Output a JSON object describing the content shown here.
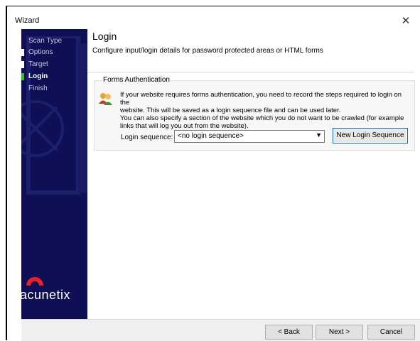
{
  "window": {
    "title": "Wizard",
    "close_glyph": "✕"
  },
  "sidebar": {
    "items": [
      {
        "label": "Scan Type",
        "state": "done"
      },
      {
        "label": "Options",
        "state": "done"
      },
      {
        "label": "Target",
        "state": "done"
      },
      {
        "label": "Login",
        "state": "active"
      },
      {
        "label": "Finish",
        "state": "pending"
      }
    ],
    "logo_text": "acunetix",
    "colors": {
      "background": "#0e0f55",
      "active_marker": "#25c725",
      "logo_red": "#e8202a"
    }
  },
  "main": {
    "title": "Login",
    "subtitle": "Configure input/login details for password protected areas or HTML forms",
    "group": {
      "label": "Forms Authentication",
      "description_lines": [
        "If your website requires forms authentication, you need to record the steps required to login on the",
        "website. This will be saved as a login sequence file and can be used later.",
        "You can also specify a section of the website which you do not want to be crawled (for example",
        "links that will log you out from the website)."
      ],
      "login_sequence_label": "Login sequence:",
      "login_sequence_value": "<no login sequence>",
      "new_login_sequence_button": "New Login Sequence"
    }
  },
  "footer": {
    "back": "< Back",
    "next": "Next >",
    "cancel": "Cancel"
  }
}
